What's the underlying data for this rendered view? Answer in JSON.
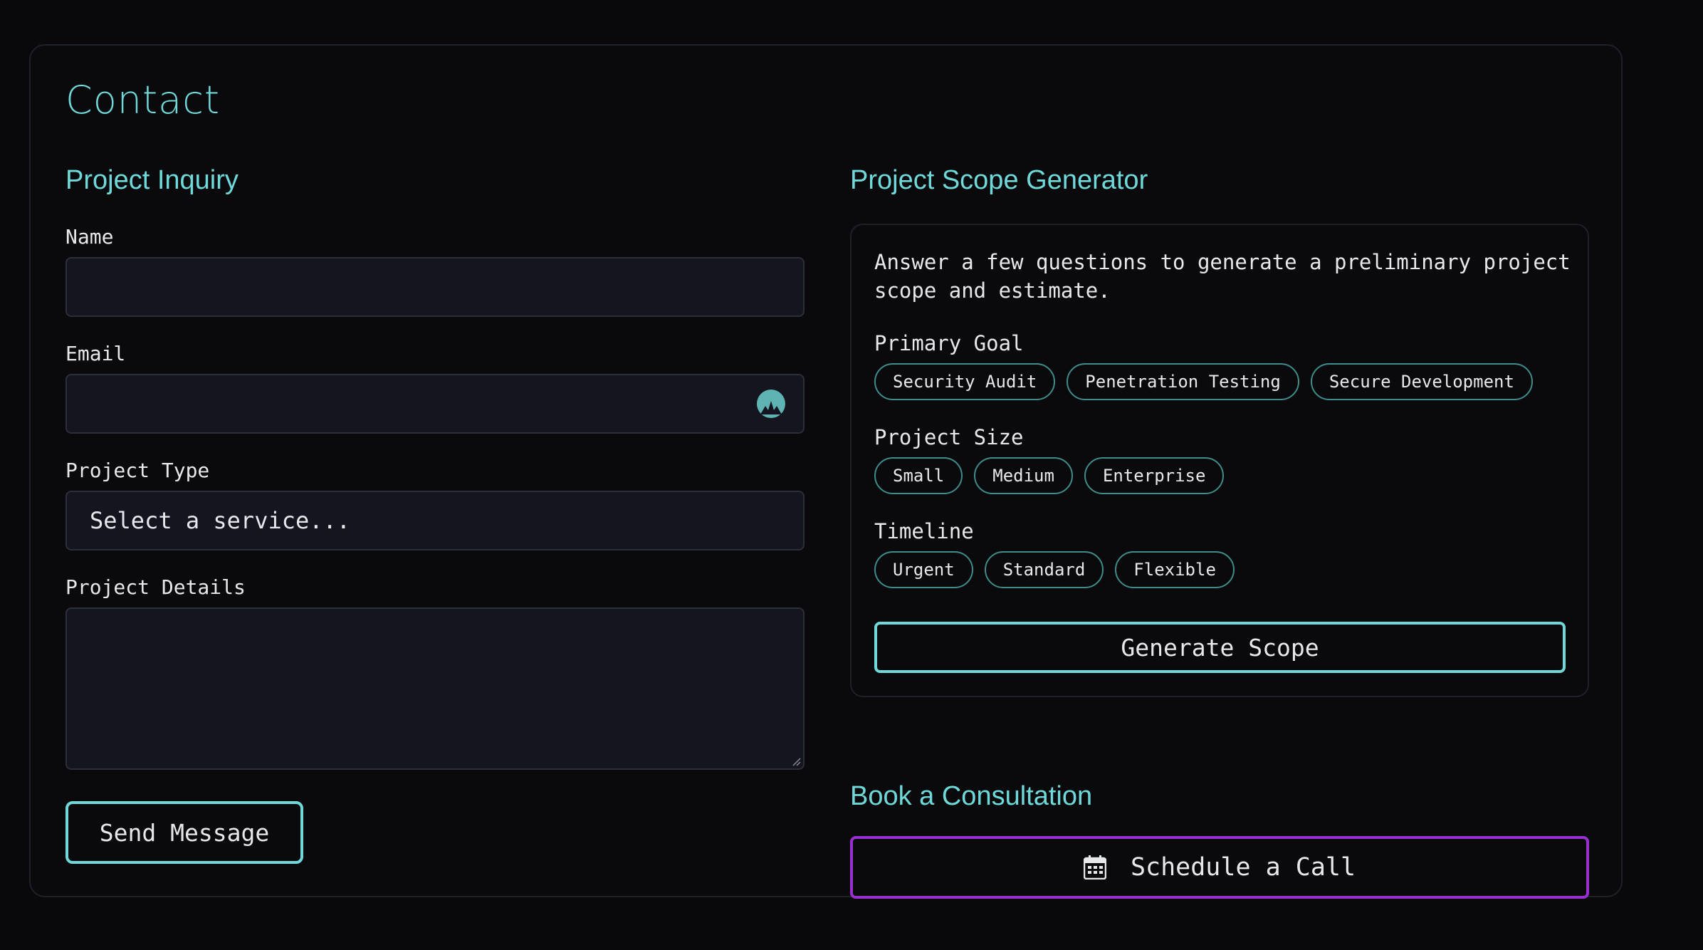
{
  "page": {
    "title": "Contact"
  },
  "inquiry": {
    "heading": "Project Inquiry",
    "name_label": "Name",
    "name_value": "",
    "email_label": "Email",
    "email_value": "",
    "email_icon": "autofill-icon",
    "type_label": "Project Type",
    "type_selected": "Select a service...",
    "details_label": "Project Details",
    "details_value": "",
    "send_label": "Send Message"
  },
  "scope": {
    "heading": "Project Scope Generator",
    "description": "Answer a few questions to generate a preliminary project scope and estimate.",
    "groups": [
      {
        "label": "Primary Goal",
        "options": [
          "Security Audit",
          "Penetration Testing",
          "Secure Development"
        ]
      },
      {
        "label": "Project Size",
        "options": [
          "Small",
          "Medium",
          "Enterprise"
        ]
      },
      {
        "label": "Timeline",
        "options": [
          "Urgent",
          "Standard",
          "Flexible"
        ]
      }
    ],
    "generate_label": "Generate Scope"
  },
  "consultation": {
    "heading": "Book a Consultation",
    "schedule_label": "Schedule a Call",
    "schedule_icon": "calendar-icon"
  },
  "colors": {
    "accent": "#6fd8d8",
    "chip_border": "#3f8c8a",
    "schedule_border": "#9a2fd0",
    "background": "#09090c",
    "input_bg": "#151520"
  }
}
